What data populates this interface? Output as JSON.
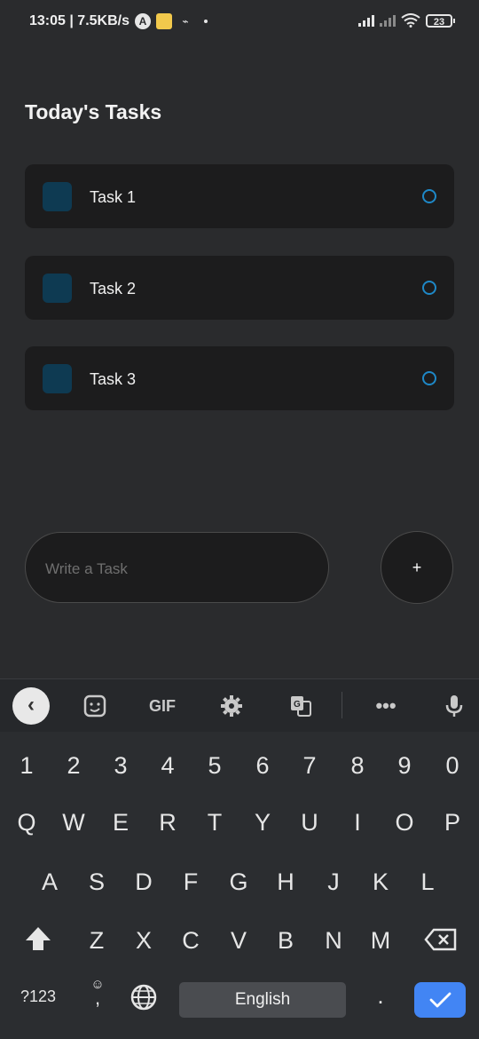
{
  "status_bar": {
    "time_speed": "13:05 | 7.5KB/s",
    "battery": "23"
  },
  "page": {
    "title": "Today's Tasks"
  },
  "tasks": [
    {
      "label": "Task 1"
    },
    {
      "label": "Task 2"
    },
    {
      "label": "Task 3"
    }
  ],
  "composer": {
    "placeholder": "Write a Task",
    "add_label": "+"
  },
  "keyboard": {
    "toolbar": {
      "gif_label": "GIF"
    },
    "number_row": [
      "1",
      "2",
      "3",
      "4",
      "5",
      "6",
      "7",
      "8",
      "9",
      "0"
    ],
    "row1": [
      "Q",
      "W",
      "E",
      "R",
      "T",
      "Y",
      "U",
      "I",
      "O",
      "P"
    ],
    "row2": [
      "A",
      "S",
      "D",
      "F",
      "G",
      "H",
      "J",
      "K",
      "L"
    ],
    "row3": [
      "Z",
      "X",
      "C",
      "V",
      "B",
      "N",
      "M"
    ],
    "symbols_label": "?123",
    "comma_label": ",",
    "space_label": "English",
    "period_label": "."
  },
  "colors": {
    "accent": "#1e88c7",
    "task_square": "#0e3a52",
    "enter_key": "#4285f4"
  }
}
